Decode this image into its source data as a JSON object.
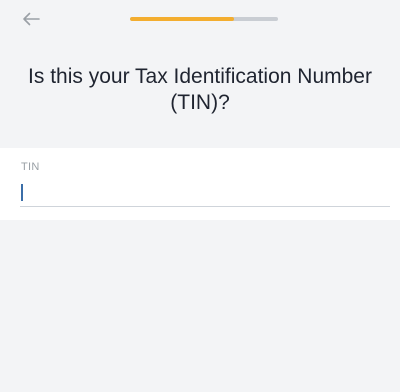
{
  "header": {
    "back_icon": "arrow-left-icon",
    "progress": {
      "fraction": 0.7,
      "fill_color": "#f3ad2f",
      "track_color": "#c9cdd3"
    },
    "title": "Is this your Tax Identification Number (TIN)?"
  },
  "form": {
    "tin_label": "TIN",
    "tin_value": "",
    "caret_color": "#3b6ea8"
  }
}
